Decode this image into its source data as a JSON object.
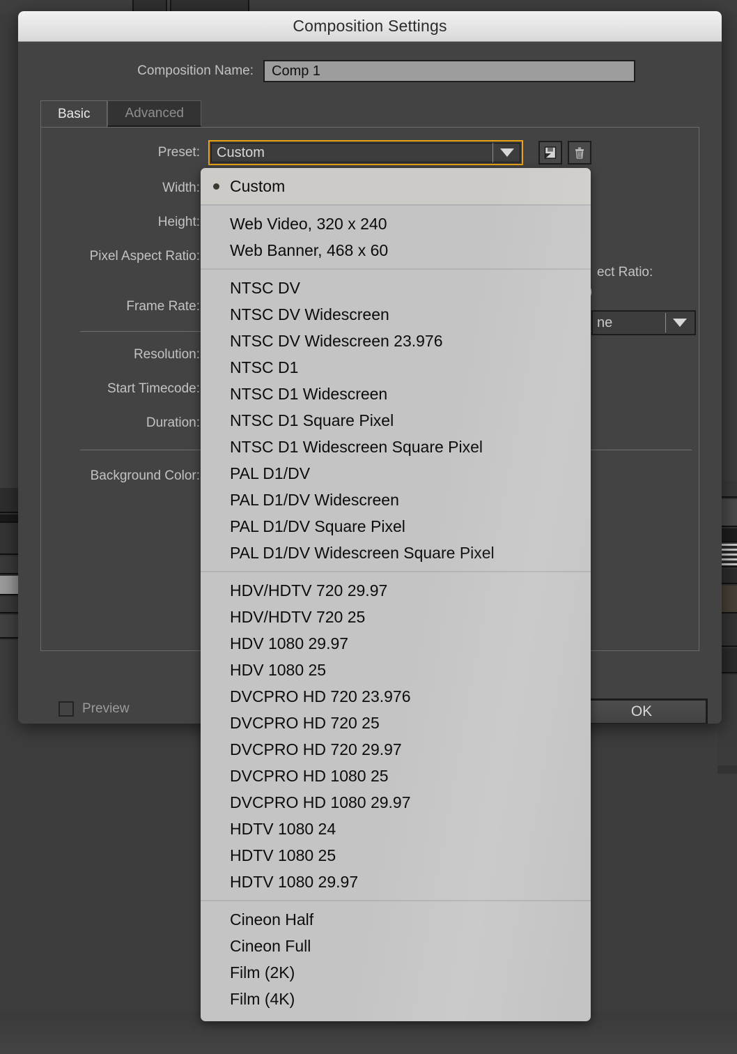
{
  "window": {
    "title": "Composition Settings"
  },
  "composition_name": {
    "label": "Composition Name:",
    "value": "Comp 1"
  },
  "tabs": [
    {
      "label": "Basic",
      "active": true
    },
    {
      "label": "Advanced",
      "active": false
    }
  ],
  "fields": {
    "preset": {
      "label": "Preset:",
      "value": "Custom"
    },
    "width": {
      "label": "Width:"
    },
    "height": {
      "label": "Height:"
    },
    "pixel_aspect_ratio": {
      "label": "Pixel Aspect Ratio:"
    },
    "frame_rate": {
      "label": "Frame Rate:"
    },
    "resolution": {
      "label": "Resolution:"
    },
    "start_timecode": {
      "label": "Start Timecode:"
    },
    "duration": {
      "label": "Duration:"
    },
    "background_color": {
      "label": "Background Color:"
    }
  },
  "occluded_fragments": {
    "aspect_ratio_label": "ect Ratio:",
    "aspect_ratio_value": ")",
    "frame_rate_value": "ne"
  },
  "buttons": {
    "save_preset": "save-preset-icon",
    "delete_preset": "trash-icon",
    "ok": "OK"
  },
  "preview": {
    "label": "Preview",
    "checked": false
  },
  "preset_menu": {
    "groups": [
      {
        "items": [
          {
            "label": "Custom",
            "selected": true
          }
        ]
      },
      {
        "items": [
          {
            "label": "Web Video, 320 x 240",
            "selected": false
          },
          {
            "label": "Web Banner, 468 x 60",
            "selected": false
          }
        ]
      },
      {
        "items": [
          {
            "label": "NTSC DV",
            "selected": false
          },
          {
            "label": "NTSC DV Widescreen",
            "selected": false
          },
          {
            "label": "NTSC DV Widescreen 23.976",
            "selected": false
          },
          {
            "label": "NTSC D1",
            "selected": false
          },
          {
            "label": "NTSC D1 Widescreen",
            "selected": false
          },
          {
            "label": "NTSC D1 Square Pixel",
            "selected": false
          },
          {
            "label": "NTSC D1 Widescreen Square Pixel",
            "selected": false
          },
          {
            "label": "PAL D1/DV",
            "selected": false
          },
          {
            "label": "PAL D1/DV Widescreen",
            "selected": false
          },
          {
            "label": "PAL D1/DV Square Pixel",
            "selected": false
          },
          {
            "label": "PAL D1/DV Widescreen Square Pixel",
            "selected": false
          }
        ]
      },
      {
        "items": [
          {
            "label": "HDV/HDTV 720 29.97",
            "selected": false
          },
          {
            "label": "HDV/HDTV 720 25",
            "selected": false
          },
          {
            "label": "HDV 1080 29.97",
            "selected": false
          },
          {
            "label": "HDV 1080 25",
            "selected": false
          },
          {
            "label": "DVCPRO HD 720 23.976",
            "selected": false
          },
          {
            "label": "DVCPRO HD 720 25",
            "selected": false
          },
          {
            "label": "DVCPRO HD 720 29.97",
            "selected": false
          },
          {
            "label": "DVCPRO HD 1080 25",
            "selected": false
          },
          {
            "label": "DVCPRO HD 1080 29.97",
            "selected": false
          },
          {
            "label": "HDTV 1080 24",
            "selected": false
          },
          {
            "label": "HDTV 1080 25",
            "selected": false
          },
          {
            "label": "HDTV 1080 29.97",
            "selected": false
          }
        ]
      },
      {
        "items": [
          {
            "label": "Cineon Half",
            "selected": false
          },
          {
            "label": "Cineon Full",
            "selected": false
          },
          {
            "label": "Film (2K)",
            "selected": false
          },
          {
            "label": "Film (4K)",
            "selected": false
          }
        ]
      }
    ]
  },
  "colors": {
    "dialog_bg": "#434343",
    "titlebar": "#e6e6e6",
    "focus_border": "#e8a317",
    "menu_bg": "#c4c4c4",
    "input_bg": "#9d9d9d"
  }
}
